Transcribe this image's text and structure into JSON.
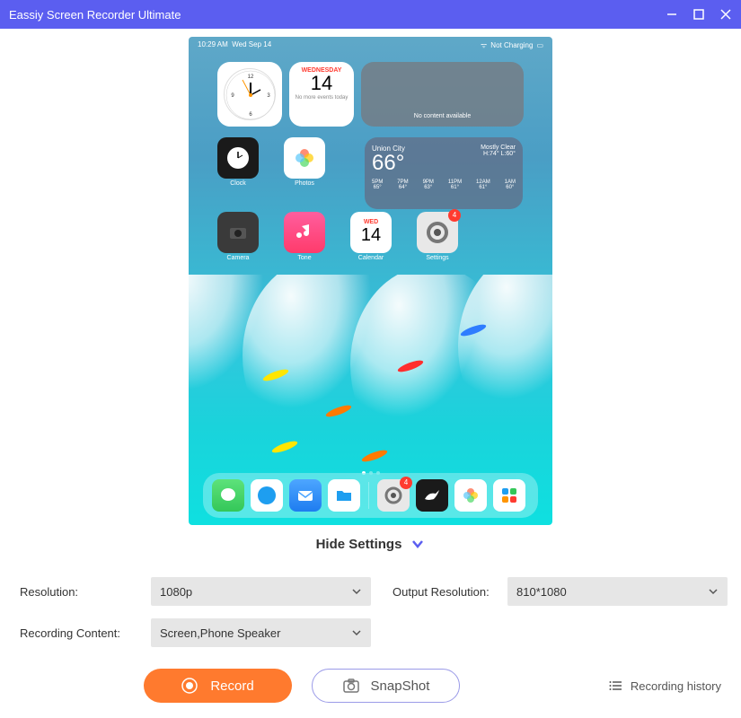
{
  "titlebar": {
    "title": "Eassiy Screen Recorder Ultimate"
  },
  "ipad": {
    "status": {
      "time": "10:29 AM",
      "date": "Wed Sep 14",
      "charging": "Not Charging"
    },
    "clock_widget": {},
    "calendar_widget": {
      "day": "WEDNESDAY",
      "date": "14",
      "sub": "No more events today"
    },
    "music_widget": {
      "text": "No content available"
    },
    "weather": {
      "city": "Union City",
      "temp": "66°",
      "condition": "Mostly Clear",
      "hilo": "H:74° L:60°",
      "hours": [
        {
          "t": "5PM",
          "v": "65°"
        },
        {
          "t": "7PM",
          "v": "64°"
        },
        {
          "t": "9PM",
          "v": "63°"
        },
        {
          "t": "11PM",
          "v": "61°"
        },
        {
          "t": "12AM",
          "v": "61°"
        },
        {
          "t": "1AM",
          "v": "60°"
        }
      ]
    },
    "apps_row1": [
      {
        "name": "Clock",
        "label": "Clock",
        "bg": "#1a1a1a"
      },
      {
        "name": "Photos",
        "label": "Photos",
        "bg": "#fff"
      }
    ],
    "apps_row2": [
      {
        "name": "Camera",
        "label": "Camera",
        "bg": "#3a3a3a"
      },
      {
        "name": "Tone",
        "label": "Tone",
        "bg": "#fff"
      },
      {
        "name": "Calendar",
        "label": "Calendar",
        "bg": "#fff",
        "date": "14",
        "day": "WED"
      },
      {
        "name": "Settings",
        "label": "Settings",
        "bg": "#e8e8e8",
        "badge": "4"
      }
    ],
    "dock": [
      {
        "name": "Messages",
        "bg": "#34c759"
      },
      {
        "name": "Safari",
        "bg": "#fff"
      },
      {
        "name": "Mail",
        "bg": "#1e7cf0"
      },
      {
        "name": "Files",
        "bg": "#fff"
      },
      {
        "sep": true
      },
      {
        "name": "Settings",
        "bg": "#e8e8e8",
        "badge": "4"
      },
      {
        "name": "Bird",
        "bg": "#1a1a1a"
      },
      {
        "name": "Photos",
        "bg": "#fff"
      },
      {
        "name": "Multi",
        "bg": "#fff"
      }
    ]
  },
  "settings_toggle": {
    "label": "Hide Settings"
  },
  "settings": {
    "resolution_label": "Resolution:",
    "resolution_value": "1080p",
    "output_label": "Output Resolution:",
    "output_value": "810*1080",
    "content_label": "Recording Content:",
    "content_value": "Screen,Phone Speaker"
  },
  "buttons": {
    "record": "Record",
    "snapshot": "SnapShot",
    "history": "Recording history"
  }
}
